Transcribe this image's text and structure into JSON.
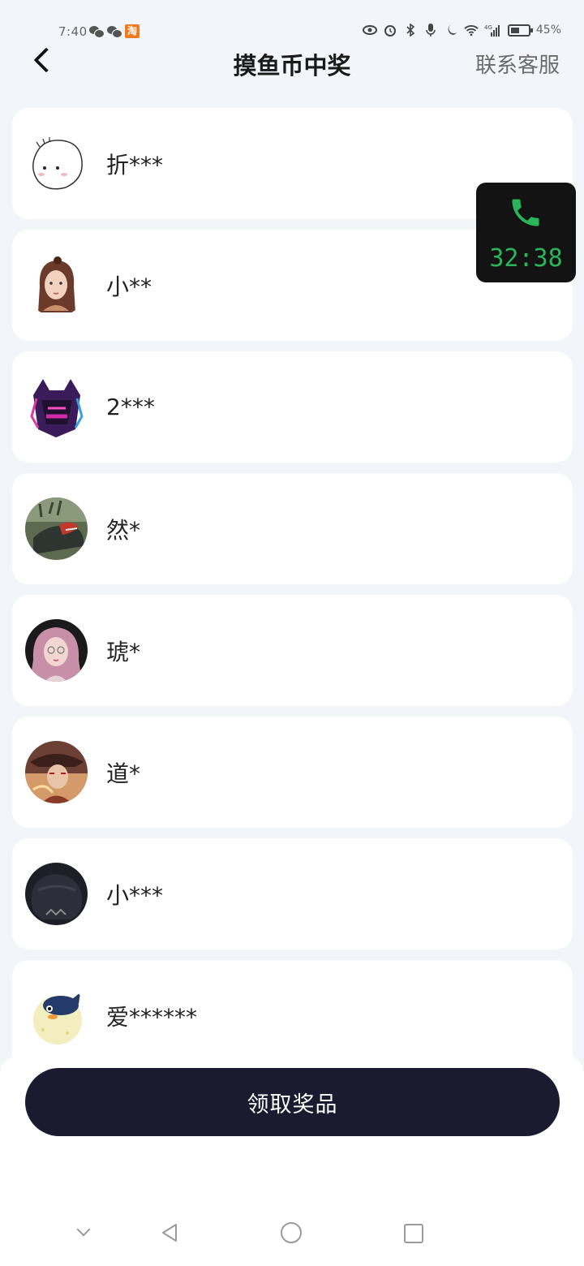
{
  "status_bar": {
    "time": "7:40",
    "taobao_glyph": "淘",
    "signal": "4G",
    "battery": "45%"
  },
  "header": {
    "title": "摸鱼币中奖",
    "contact": "联系客服"
  },
  "winners": [
    {
      "name": "折***"
    },
    {
      "name": "小**"
    },
    {
      "name": "2***"
    },
    {
      "name": "然*"
    },
    {
      "name": "琥*"
    },
    {
      "name": "道*"
    },
    {
      "name": "小***"
    },
    {
      "name": "爱******"
    }
  ],
  "call_widget": {
    "timer": "32:38",
    "icon": "phone-icon",
    "color": "#2bb55a"
  },
  "footer": {
    "claim_label": "领取奖品"
  },
  "colors": {
    "background": "#f2f5f9",
    "button": "#1b1a2e"
  }
}
